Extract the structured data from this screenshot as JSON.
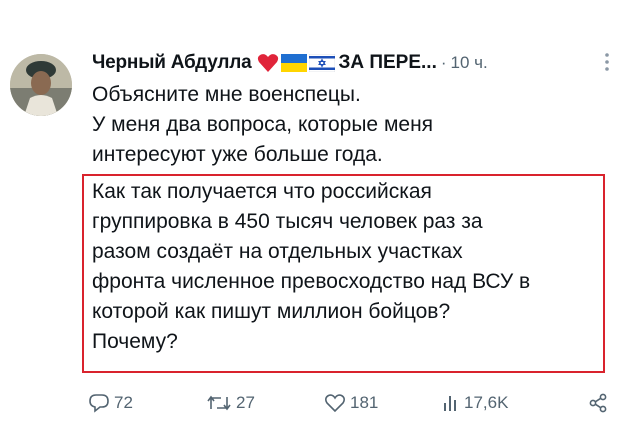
{
  "tweet": {
    "display_name": "Черный Абдулла",
    "display_name_tail": "ЗА ПЕРЕ...",
    "separator": "·",
    "time": "10 ч.",
    "plain_lines": [
      "Объясните мне военспецы.",
      "У меня два вопроса, которые меня",
      "интересуют уже больше года."
    ],
    "highlighted_lines": [
      "Как так получается что российская",
      "группировка в 450 тысяч человек раз за",
      "разом создаёт на отдельных участках",
      "фронта численное превосходство над ВСУ в",
      "которой как пишут миллион бойцов?",
      "Почему?"
    ]
  },
  "actions": {
    "replies": "72",
    "reposts": "27",
    "likes": "181",
    "views": "17,6K"
  },
  "icons": [
    "avatar",
    "heart-emoji-icon",
    "ukraine-flag-icon",
    "israel-flag-icon",
    "more-icon",
    "reply-icon",
    "repost-icon",
    "like-icon",
    "views-icon",
    "share-icon"
  ],
  "colors": {
    "highlight_border": "#d9232d",
    "secondary_text": "#536471"
  }
}
